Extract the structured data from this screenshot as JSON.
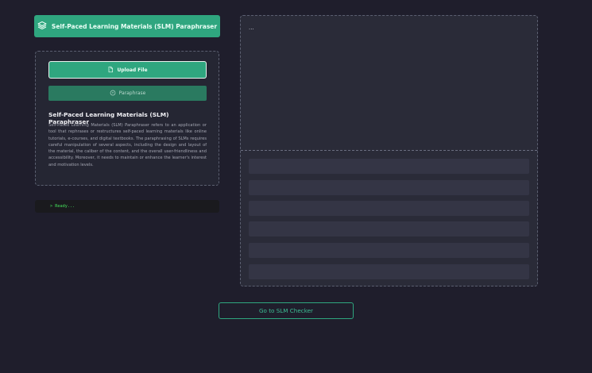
{
  "header": {
    "title": "Self-Paced Learning Materials (SLM) Paraphraser",
    "icon": "layers-icon"
  },
  "controls": {
    "upload_label": "Upload File",
    "upload_icon": "file-icon",
    "paraphrase_label": "Paraphrase",
    "paraphrase_icon": "refresh-icon"
  },
  "info": {
    "title": "Self-Paced Learning Materials (SLM) Paraphraser",
    "description": "Self-Paced Learning Materials (SLM) Paraphraser refers to an application or tool that rephrases or restructures self-paced learning materials like online tutorials, e-courses, and digital textbooks. The paraphrasing of SLMs requires careful manipulation of several aspects, including the design and layout of the material, the caliber of the content, and the overall user-friendliness and accessibility. Moreover, it needs to maintain or enhance the learner's interest and motivation levels."
  },
  "status": {
    "text": "> Ready..."
  },
  "output": {
    "text": "..."
  },
  "footer": {
    "checker_label": "Go to SLM Checker"
  },
  "colors": {
    "accent": "#2fa67f",
    "background": "#1f1e2c",
    "status_text": "#43e05a"
  }
}
